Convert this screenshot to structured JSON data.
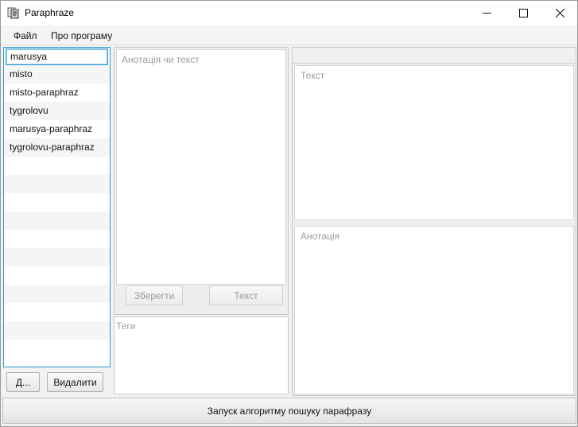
{
  "window": {
    "title": "Paraphraze",
    "app_icon": "paraphraze-app-icon",
    "controls": {
      "minimize": "minimize-icon",
      "maximize": "maximize-icon",
      "close": "close-icon"
    }
  },
  "menu": {
    "file": "Файл",
    "about": "Про програму"
  },
  "file_list": {
    "items": [
      "marusya",
      "misto",
      "misto-paraphraz",
      "tygrolovu",
      "marusya-paraphraz",
      "tygrolovu-paraphraz"
    ],
    "selected_index": 0
  },
  "left_buttons": {
    "add": "Д...",
    "delete": "Видалити"
  },
  "editor": {
    "annotation_placeholder": "Анотація чи текст",
    "save": "Зберегти",
    "text": "Текст",
    "tags_placeholder": "Теги"
  },
  "preview": {
    "text_placeholder": "Текст",
    "annotation_placeholder": "Анотація"
  },
  "run": {
    "label": "Запуск алгоритму пошуку парафразу"
  },
  "colors": {
    "focus_border": "#2d9bd0",
    "placeholder": "#9c9c9c"
  }
}
